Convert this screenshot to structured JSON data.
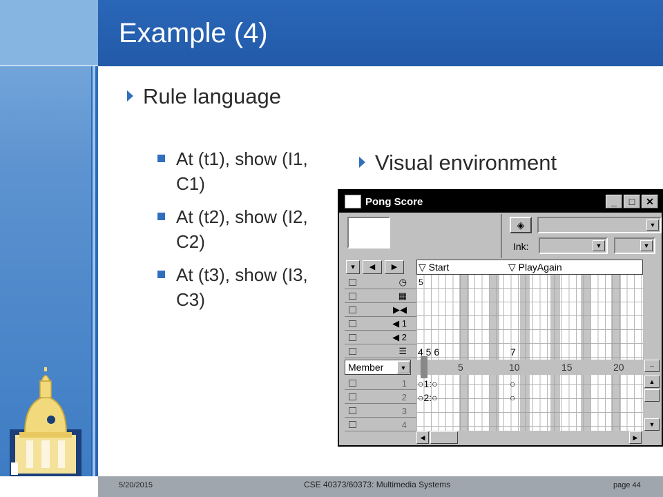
{
  "slide": {
    "title": "Example (4)",
    "bullets": [
      {
        "text": "Rule language",
        "children": [
          {
            "line1": "At (t1), show (I1,",
            "line2": "C1)"
          },
          {
            "line1": "At (t2), show (I2,",
            "line2": "C2)"
          },
          {
            "line1": "At (t3), show (I3,",
            "line2": "C3)"
          }
        ]
      },
      {
        "text": "Visual environment"
      }
    ]
  },
  "score_window": {
    "title": "Pong Score",
    "title_buttons": [
      "_",
      "□",
      "✕"
    ],
    "ink_label": "Ink:",
    "markers": [
      "Start",
      "PlayAgain"
    ],
    "member_select": "Member",
    "ruler_ticks": [
      "5",
      "10",
      "15",
      "20"
    ],
    "script_cell": "5",
    "sound_row_labels": [
      "1",
      "2"
    ],
    "sprite_row_labels": [
      "1",
      "2",
      "3",
      "4"
    ],
    "frame_cells": "4 5 6",
    "frame_cell_7": "7",
    "sprite1_cell": "1:",
    "sprite2_cell": "2:"
  },
  "footer": {
    "date": "5/20/2015",
    "course": "CSE 40373/60373: Multimedia Systems",
    "page": "page 44"
  },
  "colors": {
    "title_bar": "#225aa8",
    "accent": "#2f6fbe",
    "footer": "#9fa6ae"
  }
}
